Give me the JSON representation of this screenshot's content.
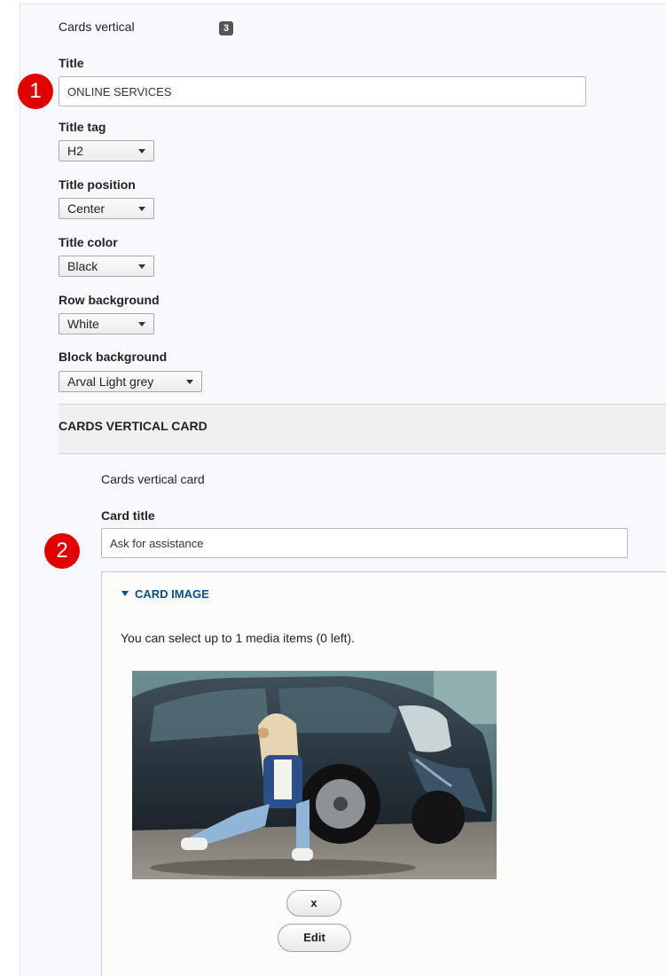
{
  "paragraph": {
    "type_label": "Cards vertical",
    "count_badge": "3"
  },
  "fields": {
    "title": {
      "label": "Title",
      "value": "ONLINE SERVICES"
    },
    "title_tag": {
      "label": "Title tag",
      "selected": "H2"
    },
    "title_position": {
      "label": "Title position",
      "selected": "Center"
    },
    "title_color": {
      "label": "Title color",
      "selected": "Black"
    },
    "row_background": {
      "label": "Row background",
      "selected": "White"
    },
    "block_background": {
      "label": "Block background",
      "selected": "Arval Light grey"
    }
  },
  "card_section": {
    "header": "CARDS VERTICAL CARD",
    "card_type_label": "Cards vertical card",
    "card_title": {
      "label": "Card title",
      "value": "Ask for assistance"
    },
    "card_image": {
      "title": "CARD IMAGE",
      "help_text": "You can select up to 1 media items (0 left).",
      "image_icon": "photo-woman-sitting-by-damaged-car",
      "remove_label": "x",
      "edit_label": "Edit"
    }
  },
  "callouts": {
    "first": "1",
    "second": "2"
  },
  "colors": {
    "callout": "#e00000",
    "link": "#0b4f7d",
    "badge": "#555555"
  }
}
